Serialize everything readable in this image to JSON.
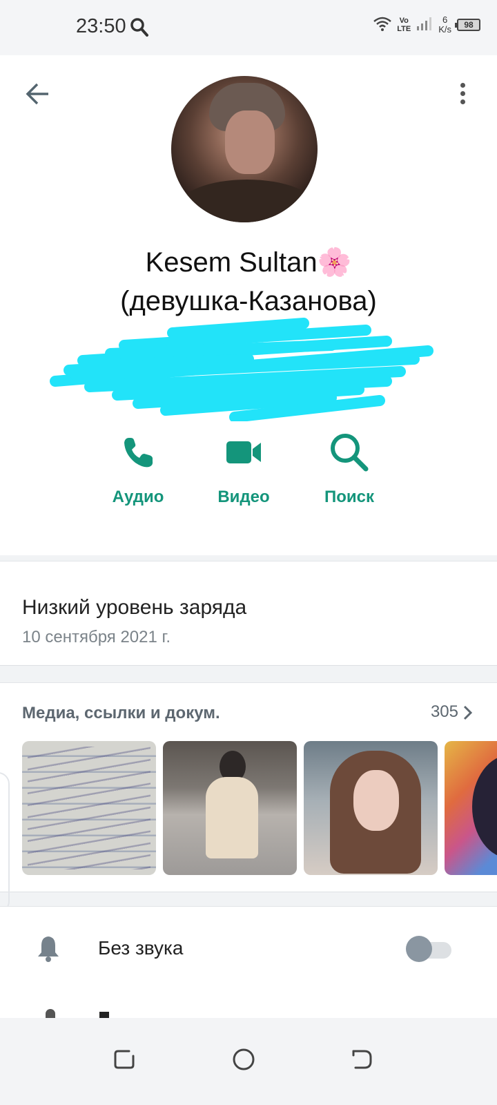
{
  "status_bar": {
    "time": "23:50",
    "network_top": "Vo",
    "network_bottom": "LTE",
    "speed_top": "6",
    "speed_bottom": "K/s",
    "battery": "98"
  },
  "header": {
    "back_icon": "arrow-left-icon",
    "more_icon": "more-vertical-icon"
  },
  "contact": {
    "name_line1": "Kesem Sultan🌸",
    "name_line2": "(девушка-Казанова)"
  },
  "actions": [
    {
      "label": "Аудио",
      "icon": "phone-icon"
    },
    {
      "label": "Видео",
      "icon": "video-camera-icon"
    },
    {
      "label": "Поиск",
      "icon": "search-icon"
    }
  ],
  "about": {
    "text": "Низкий уровень заряда",
    "date": "10 сентября 2021 г."
  },
  "media": {
    "title": "Медиа, ссылки и докум.",
    "count": "305"
  },
  "settings": {
    "mute_label": "Без звука",
    "mute_enabled": false
  },
  "colors": {
    "accent": "#14957b",
    "scribble": "#22e3f9"
  }
}
